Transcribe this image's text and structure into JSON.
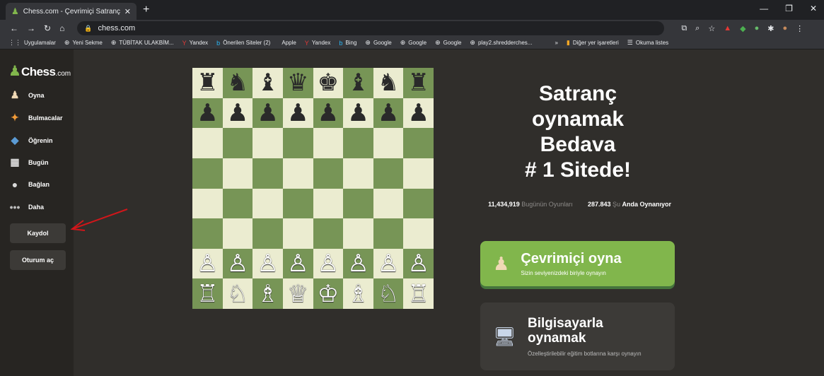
{
  "browser": {
    "tab_title": "Chess.com - Çevrimiçi Satranç O...",
    "tab_close": "✕",
    "new_tab": "+",
    "url": "chess.com",
    "window_controls": [
      "—",
      "❐",
      "✕"
    ],
    "bookmarks": [
      {
        "label": "Uygulamalar",
        "icon": "⋮⋮"
      },
      {
        "label": "Yeni Sekme",
        "icon": "⊕"
      },
      {
        "label": "TÜBİTAK ULAKBİM...",
        "icon": "⊕"
      },
      {
        "label": "Yandex",
        "icon": "Y"
      },
      {
        "label": "Önerilen Siteler (2)",
        "icon": "b"
      },
      {
        "label": "Apple",
        "icon": ""
      },
      {
        "label": "Yandex",
        "icon": "Y"
      },
      {
        "label": "Bing",
        "icon": "b"
      },
      {
        "label": "Google",
        "icon": "⊕"
      },
      {
        "label": "Google",
        "icon": "⊕"
      },
      {
        "label": "Google",
        "icon": "⊕"
      },
      {
        "label": "play2.shredderches...",
        "icon": "⊕"
      },
      {
        "label": "Diğer yer işaretleri",
        "icon": "▮"
      },
      {
        "label": "Okuma listes",
        "icon": "☰"
      }
    ]
  },
  "sidebar": {
    "logo_text": "Chess",
    "logo_suffix": ".com",
    "items": [
      {
        "label": "Oyna",
        "icon": "play-icon"
      },
      {
        "label": "Bulmacalar",
        "icon": "puzzle-icon"
      },
      {
        "label": "Öğrenin",
        "icon": "learn-icon"
      },
      {
        "label": "Bugün",
        "icon": "today-icon"
      },
      {
        "label": "Bağlan",
        "icon": "social-icon"
      },
      {
        "label": "Daha",
        "icon": "more-icon"
      }
    ],
    "signup_label": "Kaydol",
    "login_label": "Oturum aç"
  },
  "board": {
    "rows": [
      [
        "♜",
        "♞",
        "♝",
        "♛",
        "♚",
        "♝",
        "♞",
        "♜"
      ],
      [
        "♟",
        "♟",
        "♟",
        "♟",
        "♟",
        "♟",
        "♟",
        "♟"
      ],
      [
        "",
        "",
        "",
        "",
        "",
        "",
        "",
        ""
      ],
      [
        "",
        "",
        "",
        "",
        "",
        "",
        "",
        ""
      ],
      [
        "",
        "",
        "",
        "",
        "",
        "",
        "",
        ""
      ],
      [
        "",
        "",
        "",
        "",
        "",
        "",
        "",
        ""
      ],
      [
        "♙",
        "♙",
        "♙",
        "♙",
        "♙",
        "♙",
        "♙",
        "♙"
      ],
      [
        "♖",
        "♘",
        "♗",
        "♕",
        "♔",
        "♗",
        "♘",
        "♖"
      ]
    ],
    "light_color": "#ebecd0",
    "dark_color": "#779556"
  },
  "main": {
    "headline": [
      "Satranç",
      "oynamak",
      "Bedava",
      "# 1 Sitede!"
    ],
    "stats": {
      "games_number": "11,434,919",
      "games_text": "Bugünün Oyunları",
      "players_number": "287.843",
      "players_text": "Şu",
      "players_strong": "Anda Oynanıyor"
    },
    "play_online": {
      "title": "Çevrimiçi oyna",
      "subtitle": "Sizin seviyenizdeki biriyle oynayın"
    },
    "play_computer": {
      "title": "Bilgisayarla oynamak",
      "subtitle": "Özelleştirilebilir eğitim botlarına karşı oynayın"
    }
  },
  "colors": {
    "accent": "#81b64c",
    "background": "#302e2b",
    "sidebar": "#272522",
    "annotation_arrow": "#d0161a"
  }
}
